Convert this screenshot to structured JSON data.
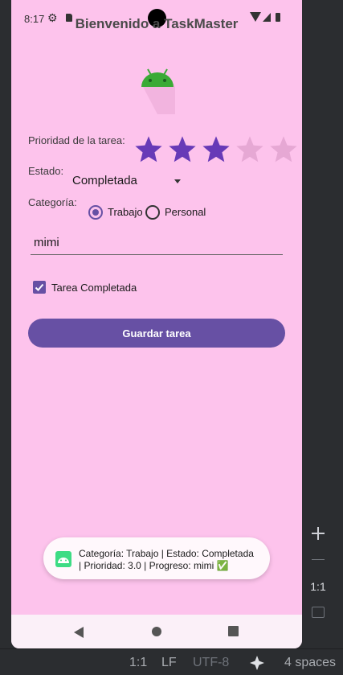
{
  "status_bar": {
    "time": "8:17"
  },
  "app": {
    "title": "Bienvenido a TaskMaster"
  },
  "form": {
    "priority_label": "Prioridad de la tarea:",
    "priority_value": 3,
    "priority_max": 5,
    "status_label": "Estado:",
    "status_value": "Completada",
    "category_label": "Categoría:",
    "category_options": [
      "Trabajo",
      "Personal"
    ],
    "category_selected": "Trabajo",
    "text_value": "mimi",
    "checkbox_label": "Tarea Completada",
    "checkbox_checked": true,
    "save_button": "Guardar tarea"
  },
  "toast": {
    "line1": "Categoría: Trabajo | Estado: Completada",
    "line2": "| Prioridad: 3.0 | Progreso: mimi ✅"
  },
  "ide_toolbar": {
    "zoom_actual": "1:1"
  },
  "ide_status": {
    "ratio": "1:1",
    "line_ending": "LF",
    "encoding": "UTF-8",
    "indent": "4 spaces"
  },
  "colors": {
    "screen_bg": "#fdc3ec",
    "accent": "#6750a4",
    "star_filled": "#673ab7",
    "star_empty": "#e6a8d4",
    "android_green": "#3ddc84"
  }
}
